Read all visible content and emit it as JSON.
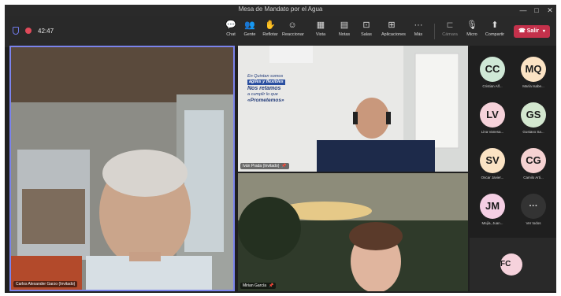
{
  "window": {
    "title": "Mesa de Mandato por el Agua"
  },
  "meeting": {
    "timer": "42:47"
  },
  "toolbar": {
    "buttons": [
      {
        "label": "Chat",
        "icon": "chat-icon",
        "glyph": "💬"
      },
      {
        "label": "Gente",
        "icon": "people-icon",
        "glyph": "👥"
      },
      {
        "label": "Reflotar",
        "icon": "raise-hand-icon",
        "glyph": "✋"
      },
      {
        "label": "Reaccionar",
        "icon": "react-icon",
        "glyph": "☺"
      },
      {
        "label": "Vista",
        "icon": "view-icon",
        "glyph": "▦"
      },
      {
        "label": "Notas",
        "icon": "notes-icon",
        "glyph": "▤"
      },
      {
        "label": "Salas",
        "icon": "rooms-icon",
        "glyph": "⊡"
      },
      {
        "label": "Aplicaciones",
        "icon": "apps-icon",
        "glyph": "⊞"
      },
      {
        "label": "Más",
        "icon": "more-icon",
        "glyph": "···"
      },
      {
        "label": "Cámara",
        "icon": "camera-icon",
        "glyph": "⊏"
      },
      {
        "label": "Micro",
        "icon": "mic-icon",
        "glyph": "🎙"
      },
      {
        "label": "Compartir",
        "icon": "share-icon",
        "glyph": "⬆"
      }
    ],
    "leave_label": "Salir",
    "leave_color": "#c4314b"
  },
  "videos": {
    "main": {
      "name": "Carlos Alexander Garzo (Invitado)"
    },
    "top_right": {
      "name": "Iván Prada (Invitado)",
      "banner": [
        "En Quintan somos",
        "ágiles y flexibles",
        "Nos retamos",
        "a cumplir lo que",
        "«Prometemos»"
      ]
    },
    "bottom_right": {
      "name": "Mirian García"
    }
  },
  "participants": [
    {
      "initials": "CC",
      "name": "Cristian Alf...",
      "bg": "#cfe8d6",
      "fg": "#1a1a1a"
    },
    {
      "initials": "MQ",
      "name": "María Isabe...",
      "bg": "#fbe3c4",
      "fg": "#1a1a1a"
    },
    {
      "initials": "LV",
      "name": "Lina Vanesa...",
      "bg": "#f6d2da",
      "fg": "#1a1a1a"
    },
    {
      "initials": "GS",
      "name": "Gustavo Sa...",
      "bg": "#d3e7cf",
      "fg": "#1a1a1a"
    },
    {
      "initials": "SV",
      "name": "Oscar Javier...",
      "bg": "#fbe3c4",
      "fg": "#1a1a1a"
    },
    {
      "initials": "CG",
      "name": "Camilo Arti...",
      "bg": "#f6d2d2",
      "fg": "#1a1a1a"
    },
    {
      "initials": "JM",
      "name": "Mejía, Juan...",
      "bg": "#f5cfe4",
      "fg": "#1a1a1a"
    },
    {
      "initials": "···",
      "name": "Ver todos",
      "bg": "#333333",
      "fg": "#e0e0e0"
    },
    {
      "initials": "FC",
      "name": "",
      "bg": "#f6d2dc",
      "fg": "#1a1a1a"
    }
  ]
}
